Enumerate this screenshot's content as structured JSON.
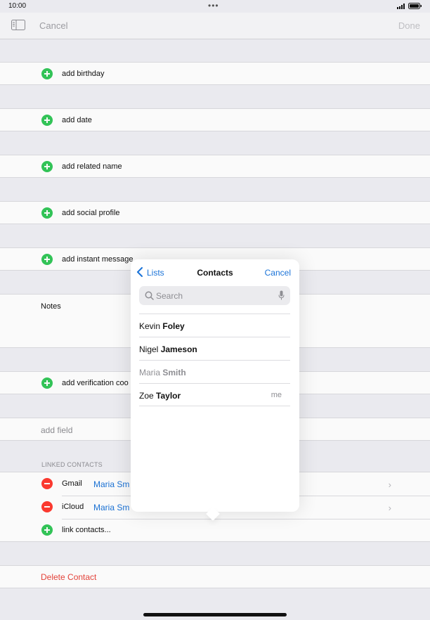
{
  "status_bar": {
    "time": "10:00"
  },
  "nav": {
    "cancel": "Cancel",
    "done": "Done"
  },
  "rows": {
    "add_birthday": "add birthday",
    "add_date": "add date",
    "add_related_name": "add related name",
    "add_social_profile": "add social profile",
    "add_instant_message": "add instant message",
    "notes": "Notes",
    "add_verification_code": "add verification coo",
    "add_field": "add field"
  },
  "linked_contacts": {
    "header": "LINKED CONTACTS",
    "items": [
      {
        "source": "Gmail",
        "name": "Maria Sm"
      },
      {
        "source": "iCloud",
        "name": "Maria Sm"
      }
    ],
    "link_label": "link contacts..."
  },
  "delete_label": "Delete Contact",
  "popover": {
    "back_label": "Lists",
    "title": "Contacts",
    "cancel": "Cancel",
    "search_placeholder": "Search",
    "contacts": [
      {
        "first": "Kevin",
        "last": "Foley",
        "tag": ""
      },
      {
        "first": "Nigel",
        "last": "Jameson",
        "tag": ""
      },
      {
        "first": "Maria",
        "last": "Smith",
        "tag": ""
      },
      {
        "first": "Zoe",
        "last": "Taylor",
        "tag": "me"
      }
    ]
  },
  "colors": {
    "accent": "#1a73d8",
    "add": "#34c759",
    "remove": "#ff3b30",
    "destructive": "#e8453c"
  },
  "icons": [
    "signal-icon",
    "battery-icon",
    "sidebar-icon",
    "plus-icon",
    "minus-icon",
    "chevron-right-icon",
    "chevron-left-icon",
    "search-icon",
    "mic-icon"
  ]
}
